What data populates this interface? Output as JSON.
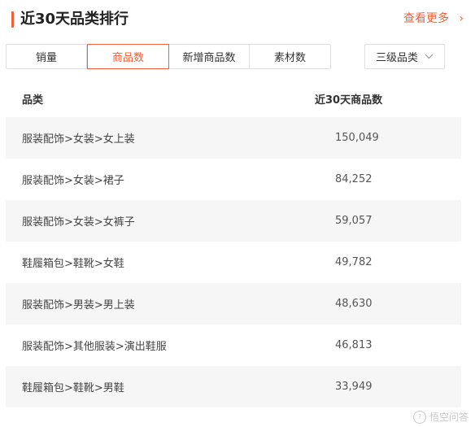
{
  "header": {
    "title": "近30天品类排行",
    "more_label": "查看更多",
    "more_chevron": "›"
  },
  "tabs": [
    {
      "label": "销量",
      "active": false
    },
    {
      "label": "商品数",
      "active": true
    },
    {
      "label": "新增商品数",
      "active": false
    },
    {
      "label": "素材数",
      "active": false
    }
  ],
  "level_select": {
    "value": "三级品类",
    "icon": "chevron-down-icon"
  },
  "table": {
    "columns": [
      "品类",
      "近30天商品数"
    ],
    "rows": [
      {
        "category": "服装配饰>女装>女上装",
        "count": "150,049"
      },
      {
        "category": "服装配饰>女装>裙子",
        "count": "84,252"
      },
      {
        "category": "服装配饰>女装>女裤子",
        "count": "59,057"
      },
      {
        "category": "鞋履箱包>鞋靴>女鞋",
        "count": "49,782"
      },
      {
        "category": "服装配饰>男装>男上装",
        "count": "48,630"
      },
      {
        "category": "服装配饰>其他服装>演出鞋服",
        "count": "46,813"
      },
      {
        "category": "鞋履箱包>鞋靴>男鞋",
        "count": "33,949"
      }
    ]
  },
  "watermark": {
    "text": "悟空问答"
  },
  "colors": {
    "accent": "#f2603a",
    "row_stripe": "#f6f6f6",
    "border": "#dedede"
  }
}
